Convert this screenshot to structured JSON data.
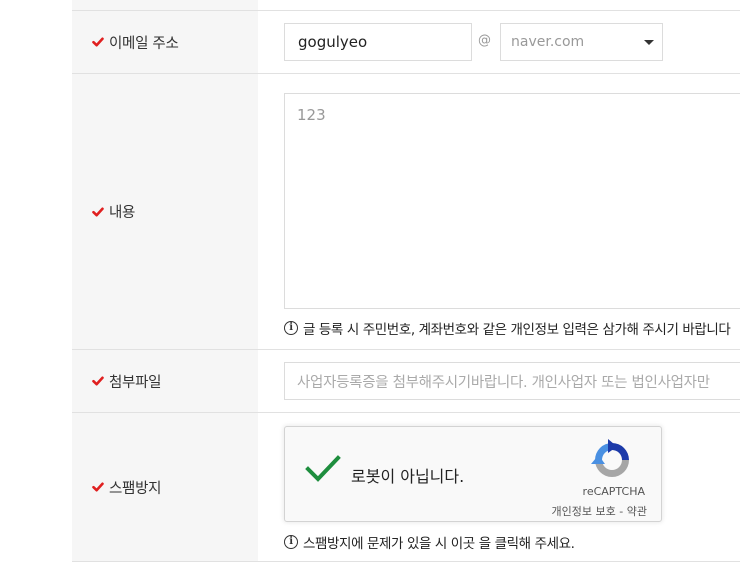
{
  "form": {
    "rows": [
      {
        "label": "이메일 주소",
        "email_local_value": "gogulyeo",
        "at_symbol": "@",
        "domain_select_value": "naver.com"
      },
      {
        "label": "내용",
        "content_placeholder": "123",
        "notice": "글 등록 시 주민번호, 계좌번호와 같은 개인정보 입력은 삼가해 주시기 바랍니다"
      },
      {
        "label": "첨부파일",
        "file_placeholder": "사업자등록증을 첨부해주시기바랍니다. 개인사업자 또는 법인사업자만"
      },
      {
        "label": "스팸방지",
        "recaptcha": {
          "checkbox_label": "로봇이 아닙니다.",
          "brand": "reCAPTCHA",
          "privacy_link": "개인정보 보호",
          "separator": "-",
          "terms_link": "약관"
        },
        "notice": "스팸방지에 문제가 있을 시 이곳 을 클릭해 주세요."
      }
    ]
  },
  "icons": {
    "required_check": "required-check-icon",
    "info": "info-icon",
    "dropdown": "chevron-down-icon",
    "recaptcha_check": "checkmark-icon",
    "recaptcha_logo": "recaptcha-logo-icon"
  },
  "colors": {
    "required_mark": "#e02020",
    "label_background": "#f6f6f6",
    "recaptcha_check": "#1e8e3e",
    "recaptcha_logo_blue": "#1c3aa9",
    "recaptcha_logo_light": "#4a90e2",
    "recaptcha_logo_gray": "#a6a6a6"
  }
}
